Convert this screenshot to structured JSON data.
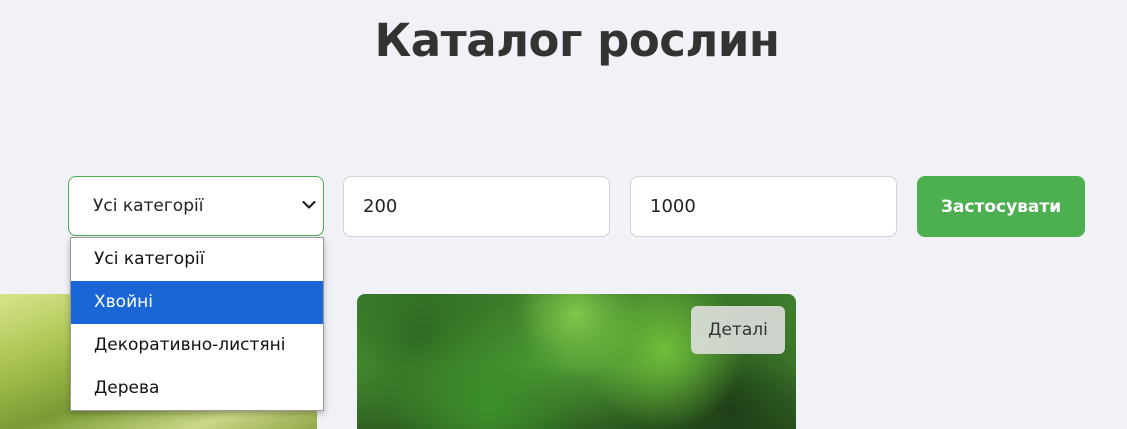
{
  "page": {
    "title": "Каталог рослин"
  },
  "filters": {
    "category_value": "Усі категорії",
    "min_price": "200",
    "max_price": "1000",
    "apply_label": "Застосувати",
    "category_options": [
      {
        "label": "Усі категорії",
        "highlighted": false
      },
      {
        "label": "Хвойні",
        "highlighted": true
      },
      {
        "label": "Декоративно-листяні",
        "highlighted": false
      },
      {
        "label": "Дерева",
        "highlighted": false
      }
    ]
  },
  "cards": [
    {
      "image": "leaves-photo"
    },
    {
      "image": "green-shrubs-photo",
      "details_label": "Деталі"
    }
  ],
  "colors": {
    "accent": "#4caf50",
    "highlight": "#1a66d6",
    "background": "#f0f2f7"
  }
}
